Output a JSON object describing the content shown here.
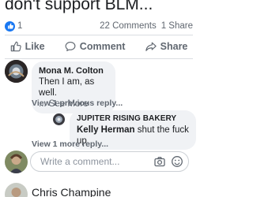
{
  "post": {
    "headline": "don't support BLM...",
    "reaction_count": "1",
    "comments_count": "22 Comments",
    "shares_count": "1 Share"
  },
  "actions": {
    "like_label": "Like",
    "comment_label": "Comment",
    "share_label": "Share"
  },
  "comments": [
    {
      "author": "Mona M. Colton",
      "text": "Then I am, as well.",
      "see_more": "... See More",
      "previous_replies": "View 1 previous reply..."
    }
  ],
  "reply": {
    "page_name": "JUPITER RISING BAKERY",
    "tagged_name": "Kelly Herman",
    "text": " shut the fuck up",
    "more_replies": "View 1 more reply..."
  },
  "composer": {
    "placeholder": "Write a comment..."
  },
  "next_comment": {
    "author": "Chris Champine"
  },
  "colors": {
    "accent": "#1877f2",
    "muted": "#606770",
    "bubble": "#f0f2f5"
  }
}
